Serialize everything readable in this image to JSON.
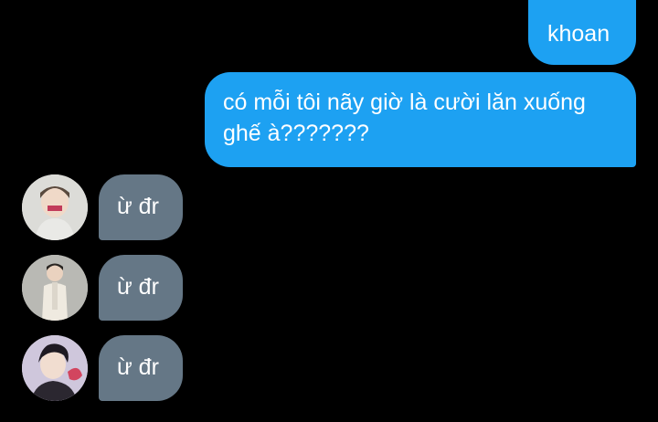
{
  "messages": [
    {
      "side": "sent",
      "text": "khoan"
    },
    {
      "side": "sent",
      "text": "có mỗi tôi nãy giờ là cười lăn xuống ghế à???????"
    },
    {
      "side": "received",
      "text": "ừ đr"
    },
    {
      "side": "received",
      "text": "ừ đr"
    },
    {
      "side": "received",
      "text": "ừ đr"
    }
  ],
  "colors": {
    "background": "#000000",
    "sent_bubble": "#1da1f2",
    "received_bubble": "#657786",
    "text": "#ffffff"
  }
}
